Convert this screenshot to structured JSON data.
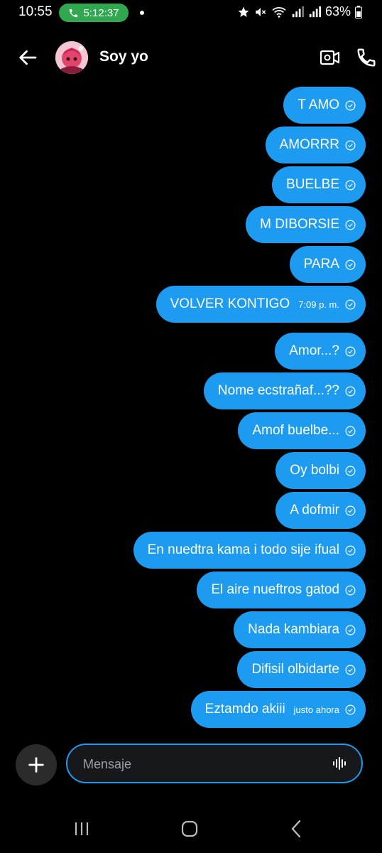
{
  "status_bar": {
    "time": "10:55",
    "call_duration": "5:12:37",
    "battery": "63%"
  },
  "header": {
    "contact_name": "Soy yo",
    "icons": [
      "back-arrow-icon",
      "avatar",
      "video-call-icon",
      "phone-icon"
    ]
  },
  "messages": [
    {
      "text": "T AMO",
      "time": ""
    },
    {
      "text": "AMORRR",
      "time": ""
    },
    {
      "text": "BUELBE",
      "time": ""
    },
    {
      "text": "M DIBORSIE",
      "time": ""
    },
    {
      "text": "PARA",
      "time": ""
    },
    {
      "text": "VOLVER KONTIGO",
      "time": "7:09 p. m."
    },
    {
      "text": "Amor...?",
      "time": ""
    },
    {
      "text": "Nome ecstrañaf...??",
      "time": ""
    },
    {
      "text": "Amof buelbe...",
      "time": ""
    },
    {
      "text": "Oy bolbi",
      "time": ""
    },
    {
      "text": "A dofmir",
      "time": ""
    },
    {
      "text": "En nuedtra kama i todo sije ifual",
      "time": ""
    },
    {
      "text": "El aire nueftros gatod",
      "time": ""
    },
    {
      "text": "Nada kambiara",
      "time": ""
    },
    {
      "text": "Difisil olbidarte",
      "time": ""
    },
    {
      "text": "Eztamdo akiii",
      "time": "justo ahora"
    }
  ],
  "composer": {
    "placeholder": "Mensaje"
  },
  "colors": {
    "bubble": "#1d9bf0",
    "background": "#000000",
    "call_pill": "#2fa84f"
  }
}
